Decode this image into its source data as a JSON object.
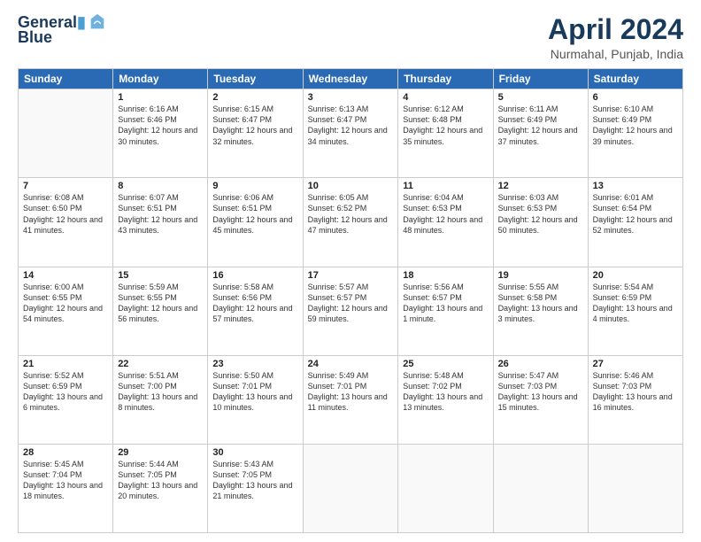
{
  "header": {
    "logo_line1": "General",
    "logo_line2": "Blue",
    "month": "April 2024",
    "location": "Nurmahal, Punjab, India"
  },
  "weekdays": [
    "Sunday",
    "Monday",
    "Tuesday",
    "Wednesday",
    "Thursday",
    "Friday",
    "Saturday"
  ],
  "weeks": [
    [
      {
        "day": "",
        "sunrise": "",
        "sunset": "",
        "daylight": ""
      },
      {
        "day": "1",
        "sunrise": "Sunrise: 6:16 AM",
        "sunset": "Sunset: 6:46 PM",
        "daylight": "Daylight: 12 hours and 30 minutes."
      },
      {
        "day": "2",
        "sunrise": "Sunrise: 6:15 AM",
        "sunset": "Sunset: 6:47 PM",
        "daylight": "Daylight: 12 hours and 32 minutes."
      },
      {
        "day": "3",
        "sunrise": "Sunrise: 6:13 AM",
        "sunset": "Sunset: 6:47 PM",
        "daylight": "Daylight: 12 hours and 34 minutes."
      },
      {
        "day": "4",
        "sunrise": "Sunrise: 6:12 AM",
        "sunset": "Sunset: 6:48 PM",
        "daylight": "Daylight: 12 hours and 35 minutes."
      },
      {
        "day": "5",
        "sunrise": "Sunrise: 6:11 AM",
        "sunset": "Sunset: 6:49 PM",
        "daylight": "Daylight: 12 hours and 37 minutes."
      },
      {
        "day": "6",
        "sunrise": "Sunrise: 6:10 AM",
        "sunset": "Sunset: 6:49 PM",
        "daylight": "Daylight: 12 hours and 39 minutes."
      }
    ],
    [
      {
        "day": "7",
        "sunrise": "Sunrise: 6:08 AM",
        "sunset": "Sunset: 6:50 PM",
        "daylight": "Daylight: 12 hours and 41 minutes."
      },
      {
        "day": "8",
        "sunrise": "Sunrise: 6:07 AM",
        "sunset": "Sunset: 6:51 PM",
        "daylight": "Daylight: 12 hours and 43 minutes."
      },
      {
        "day": "9",
        "sunrise": "Sunrise: 6:06 AM",
        "sunset": "Sunset: 6:51 PM",
        "daylight": "Daylight: 12 hours and 45 minutes."
      },
      {
        "day": "10",
        "sunrise": "Sunrise: 6:05 AM",
        "sunset": "Sunset: 6:52 PM",
        "daylight": "Daylight: 12 hours and 47 minutes."
      },
      {
        "day": "11",
        "sunrise": "Sunrise: 6:04 AM",
        "sunset": "Sunset: 6:53 PM",
        "daylight": "Daylight: 12 hours and 48 minutes."
      },
      {
        "day": "12",
        "sunrise": "Sunrise: 6:03 AM",
        "sunset": "Sunset: 6:53 PM",
        "daylight": "Daylight: 12 hours and 50 minutes."
      },
      {
        "day": "13",
        "sunrise": "Sunrise: 6:01 AM",
        "sunset": "Sunset: 6:54 PM",
        "daylight": "Daylight: 12 hours and 52 minutes."
      }
    ],
    [
      {
        "day": "14",
        "sunrise": "Sunrise: 6:00 AM",
        "sunset": "Sunset: 6:55 PM",
        "daylight": "Daylight: 12 hours and 54 minutes."
      },
      {
        "day": "15",
        "sunrise": "Sunrise: 5:59 AM",
        "sunset": "Sunset: 6:55 PM",
        "daylight": "Daylight: 12 hours and 56 minutes."
      },
      {
        "day": "16",
        "sunrise": "Sunrise: 5:58 AM",
        "sunset": "Sunset: 6:56 PM",
        "daylight": "Daylight: 12 hours and 57 minutes."
      },
      {
        "day": "17",
        "sunrise": "Sunrise: 5:57 AM",
        "sunset": "Sunset: 6:57 PM",
        "daylight": "Daylight: 12 hours and 59 minutes."
      },
      {
        "day": "18",
        "sunrise": "Sunrise: 5:56 AM",
        "sunset": "Sunset: 6:57 PM",
        "daylight": "Daylight: 13 hours and 1 minute."
      },
      {
        "day": "19",
        "sunrise": "Sunrise: 5:55 AM",
        "sunset": "Sunset: 6:58 PM",
        "daylight": "Daylight: 13 hours and 3 minutes."
      },
      {
        "day": "20",
        "sunrise": "Sunrise: 5:54 AM",
        "sunset": "Sunset: 6:59 PM",
        "daylight": "Daylight: 13 hours and 4 minutes."
      }
    ],
    [
      {
        "day": "21",
        "sunrise": "Sunrise: 5:52 AM",
        "sunset": "Sunset: 6:59 PM",
        "daylight": "Daylight: 13 hours and 6 minutes."
      },
      {
        "day": "22",
        "sunrise": "Sunrise: 5:51 AM",
        "sunset": "Sunset: 7:00 PM",
        "daylight": "Daylight: 13 hours and 8 minutes."
      },
      {
        "day": "23",
        "sunrise": "Sunrise: 5:50 AM",
        "sunset": "Sunset: 7:01 PM",
        "daylight": "Daylight: 13 hours and 10 minutes."
      },
      {
        "day": "24",
        "sunrise": "Sunrise: 5:49 AM",
        "sunset": "Sunset: 7:01 PM",
        "daylight": "Daylight: 13 hours and 11 minutes."
      },
      {
        "day": "25",
        "sunrise": "Sunrise: 5:48 AM",
        "sunset": "Sunset: 7:02 PM",
        "daylight": "Daylight: 13 hours and 13 minutes."
      },
      {
        "day": "26",
        "sunrise": "Sunrise: 5:47 AM",
        "sunset": "Sunset: 7:03 PM",
        "daylight": "Daylight: 13 hours and 15 minutes."
      },
      {
        "day": "27",
        "sunrise": "Sunrise: 5:46 AM",
        "sunset": "Sunset: 7:03 PM",
        "daylight": "Daylight: 13 hours and 16 minutes."
      }
    ],
    [
      {
        "day": "28",
        "sunrise": "Sunrise: 5:45 AM",
        "sunset": "Sunset: 7:04 PM",
        "daylight": "Daylight: 13 hours and 18 minutes."
      },
      {
        "day": "29",
        "sunrise": "Sunrise: 5:44 AM",
        "sunset": "Sunset: 7:05 PM",
        "daylight": "Daylight: 13 hours and 20 minutes."
      },
      {
        "day": "30",
        "sunrise": "Sunrise: 5:43 AM",
        "sunset": "Sunset: 7:05 PM",
        "daylight": "Daylight: 13 hours and 21 minutes."
      },
      {
        "day": "",
        "sunrise": "",
        "sunset": "",
        "daylight": ""
      },
      {
        "day": "",
        "sunrise": "",
        "sunset": "",
        "daylight": ""
      },
      {
        "day": "",
        "sunrise": "",
        "sunset": "",
        "daylight": ""
      },
      {
        "day": "",
        "sunrise": "",
        "sunset": "",
        "daylight": ""
      }
    ]
  ]
}
